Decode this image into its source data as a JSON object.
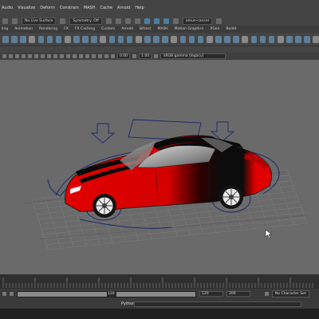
{
  "menu": [
    "Audio",
    "Visualize",
    "Deform",
    "Constrain",
    "MASH",
    "Cache",
    "Arnold",
    "Help"
  ],
  "status_line": {
    "live_surface": "No Live Surface",
    "symmetry": "Symmetry: Off",
    "workspace": "amun-cancel"
  },
  "shelf_tabs": [
    "ling",
    "Animation",
    "Rendering",
    "FX",
    "FX Caching",
    "Custom",
    "Arnold",
    "Bifrost",
    "MASH",
    "Motion Graphics",
    "XGen",
    "Bullet"
  ],
  "panel_toolbar": {
    "field_a": "0.00",
    "field_b": "1.00",
    "colorspace": "sRGB gamma (legacy)"
  },
  "time_slider": {
    "current_field": "120",
    "range_end_a": "120",
    "range_end_b": "200",
    "anim_layer": "No Character Set"
  },
  "command_line": {
    "label": "Python"
  },
  "colors": {
    "car_red": "#e00000",
    "car_black": "#0c0c0c",
    "nurbs_blue": "#1a2a6c",
    "viewport_bg": "#6a6a6a"
  }
}
